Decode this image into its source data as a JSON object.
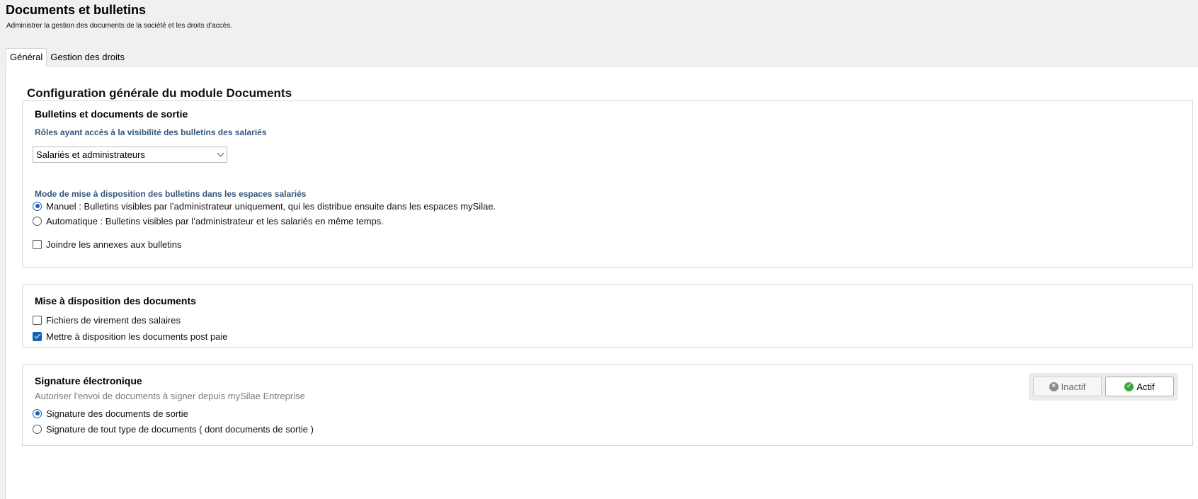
{
  "header": {
    "title": "Documents et bulletins",
    "subtitle": "Administrer la gestion des documents de la société et les droits d’accès."
  },
  "tabs": [
    {
      "label": "Général",
      "active": true
    },
    {
      "label": "Gestion des droits",
      "active": false
    }
  ],
  "main": {
    "heading": "Configuration générale du module Documents",
    "bulletins": {
      "title": "Bulletins et documents de sortie",
      "roles_label": "Rôles ayant accès à la visibilité des bulletins des salariés",
      "roles_value": "Salariés et administrateurs",
      "mode_label": "Mode de mise à disposition des bulletins dans les espaces salariés",
      "mode_options": [
        {
          "label": "Manuel : Bulletins visibles par l’administrateur uniquement, qui les distribue ensuite dans les espaces mySilae.",
          "selected": true
        },
        {
          "label": "Automatique : Bulletins visibles par l’administrateur et les salariés en même temps.",
          "selected": false
        }
      ],
      "annexes": {
        "label": "Joindre les annexes aux bulletins",
        "checked": false
      }
    },
    "documents": {
      "title": "Mise à disposition des documents",
      "options": [
        {
          "label": "Fichiers de virement des salaires",
          "checked": false
        },
        {
          "label": "Mettre à disposition les documents post paie",
          "checked": true
        }
      ]
    },
    "signature": {
      "title": "Signature électronique",
      "description": "Autoriser l'envoi de documents à signer depuis mySilae Entreprise",
      "toggle": {
        "inactive_label": "Inactif",
        "active_label": "Actif",
        "state": "Actif"
      },
      "options": [
        {
          "label": "Signature des documents de sortie",
          "selected": true
        },
        {
          "label": "Signature de tout type de documents ( dont documents de sortie )",
          "selected": false
        }
      ]
    }
  },
  "colors": {
    "accent_blue": "#1462b3",
    "label_blue": "#34577c",
    "active_green": "#3aab3a"
  }
}
